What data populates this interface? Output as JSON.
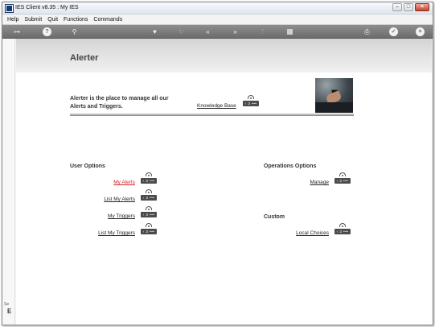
{
  "window": {
    "title": "IES Client v8.35 : My IES"
  },
  "menu": [
    "Help",
    "Submit",
    "Quit",
    "Functions",
    "Commands"
  ],
  "toolbar": {
    "icons": [
      "key-icon",
      "help-icon",
      "search-icon",
      "heart-icon",
      "refresh-icon",
      "back-icon",
      "forward-icon",
      "upload-icon",
      "stop-icon",
      "print-icon",
      "check-icon",
      "close-icon"
    ]
  },
  "left_strip": {
    "label1": "Se",
    "label2": "E"
  },
  "page": {
    "title": "Alerter",
    "intro": "Alerter is the place to manage all our Alerts and Triggers.",
    "kb_link": "Knowledge Base"
  },
  "user_options": {
    "title": "User Options",
    "items": [
      "My Alerts",
      "List My Alerts",
      "My Triggers",
      "List My Triggers"
    ]
  },
  "operations_options": {
    "title": "Operations Options",
    "items": [
      "Manage"
    ]
  },
  "custom": {
    "title": "Custom",
    "items": [
      "Local Choices"
    ]
  },
  "badge_text": "‹ 3 •••",
  "colors": {
    "active_link": "#d42020",
    "toolbar": "#7a7a7a"
  }
}
